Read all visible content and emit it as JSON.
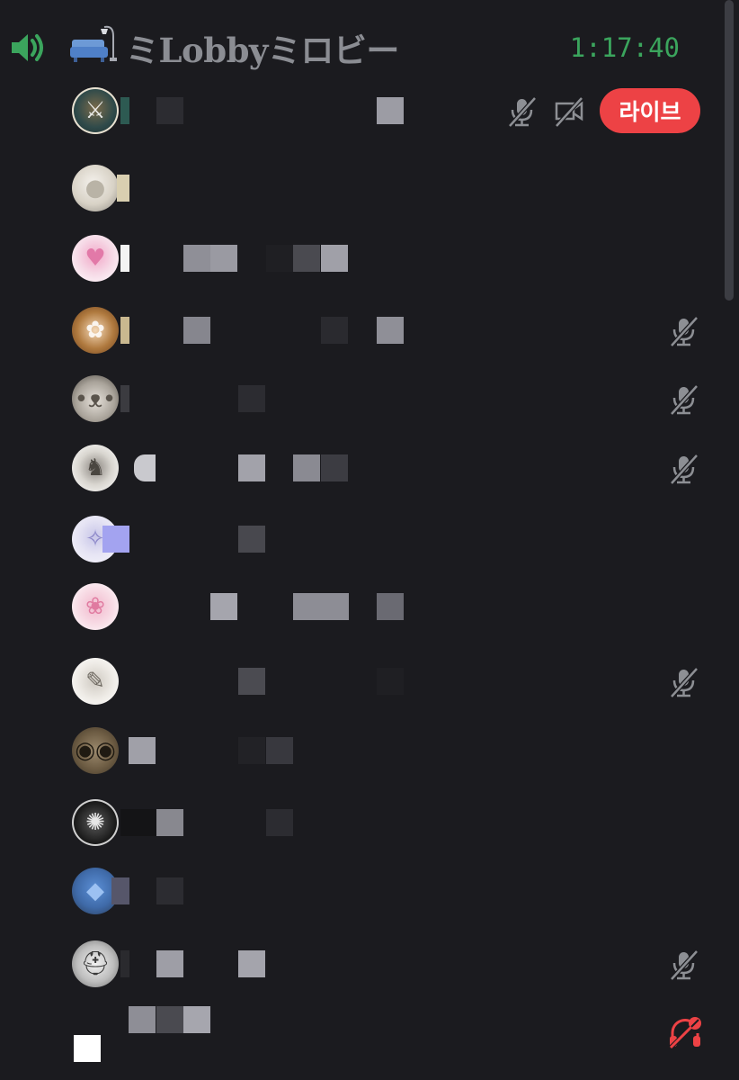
{
  "channel": {
    "name": "ミLobbyミロビー",
    "elapsed": "1:17:40",
    "speaker_icon": "speaker-icon",
    "channel_icon": "couch-icon"
  },
  "live_label": "라이브",
  "colors": {
    "background": "#1b1b1f",
    "accent_green": "#3ba55d",
    "live_red": "#ed4245",
    "muted_icon": "#8d8f94",
    "deafened_red": "#ed4245"
  },
  "members": [
    {
      "avatar": "dark fantasy character",
      "muted": true,
      "video_off": true,
      "live": true
    },
    {
      "avatar": "white plush",
      "muted": false
    },
    {
      "avatar": "pink haired anime girl",
      "muted": false
    },
    {
      "avatar": "brown haired anime girl",
      "muted": true
    },
    {
      "avatar": "cat",
      "muted": true
    },
    {
      "avatar": "knights illustration",
      "muted": true
    },
    {
      "avatar": "silver haired anime girl",
      "muted": false
    },
    {
      "avatar": "pink sketch girl",
      "muted": false
    },
    {
      "avatar": "line art girl",
      "muted": true
    },
    {
      "avatar": "surprised cat",
      "muted": false
    },
    {
      "avatar": "monochrome art",
      "muted": false
    },
    {
      "avatar": "blue figure",
      "muted": false
    },
    {
      "avatar": "white helmet",
      "muted": true
    },
    {
      "avatar": "none",
      "muted": false,
      "deafened": true
    }
  ]
}
